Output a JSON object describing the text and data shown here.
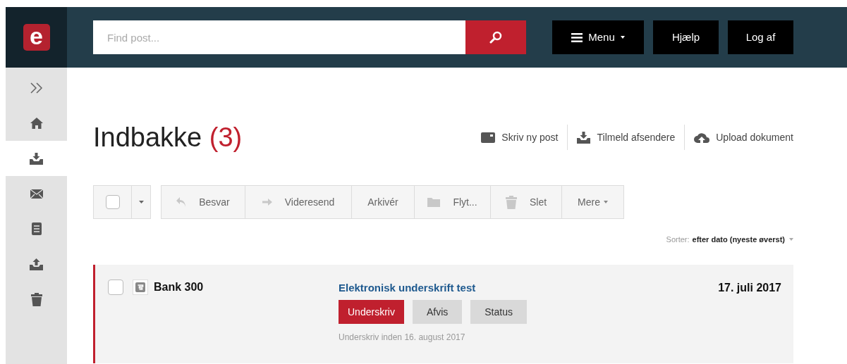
{
  "logo": {
    "text": "e"
  },
  "search": {
    "placeholder": "Find post..."
  },
  "header_buttons": [
    {
      "label": "Menu",
      "kind": "menu"
    },
    {
      "label": "Hjælp",
      "kind": "plain"
    },
    {
      "label": "Log af",
      "kind": "plain"
    }
  ],
  "sidebar": {
    "items": [
      {
        "kind": "expand",
        "selected": false
      },
      {
        "kind": "home",
        "selected": false
      },
      {
        "kind": "inbox",
        "selected": true
      },
      {
        "kind": "mail",
        "selected": false
      },
      {
        "kind": "document",
        "selected": false
      },
      {
        "kind": "upload",
        "selected": false
      },
      {
        "kind": "trash",
        "selected": false
      }
    ]
  },
  "title": {
    "text": "Indbakke",
    "count": "(3)"
  },
  "page_actions": [
    {
      "label": "Skriv ny post",
      "kind": "compose"
    },
    {
      "label": "Tilmeld afsendere",
      "kind": "inbox"
    },
    {
      "label": "Upload dokument",
      "kind": "cloud"
    }
  ],
  "toolbar": {
    "select_all": {
      "checked": false
    },
    "buttons": [
      {
        "label": "Besvar",
        "kind": "reply"
      },
      {
        "label": "Videresend",
        "kind": "forward"
      },
      {
        "label": "Arkivér",
        "kind": "plain"
      },
      {
        "label": "Flyt...",
        "kind": "folder"
      },
      {
        "label": "Slet",
        "kind": "trash"
      },
      {
        "label": "Mere",
        "kind": "dropdown"
      }
    ]
  },
  "sort": {
    "label": "Sorter:",
    "value": "efter dato (nyeste øverst)"
  },
  "messages": [
    {
      "checked": false,
      "sender": "Bank 300",
      "subject": "Elektronisk underskrift test",
      "date": "17. juli 2017",
      "unread": true,
      "actions": [
        {
          "label": "Underskriv",
          "kind": "primary"
        },
        {
          "label": "Afvis",
          "kind": "secondary"
        },
        {
          "label": "Status",
          "kind": "secondary"
        }
      ],
      "note": "Underskriv inden 16. august 2017"
    }
  ]
}
